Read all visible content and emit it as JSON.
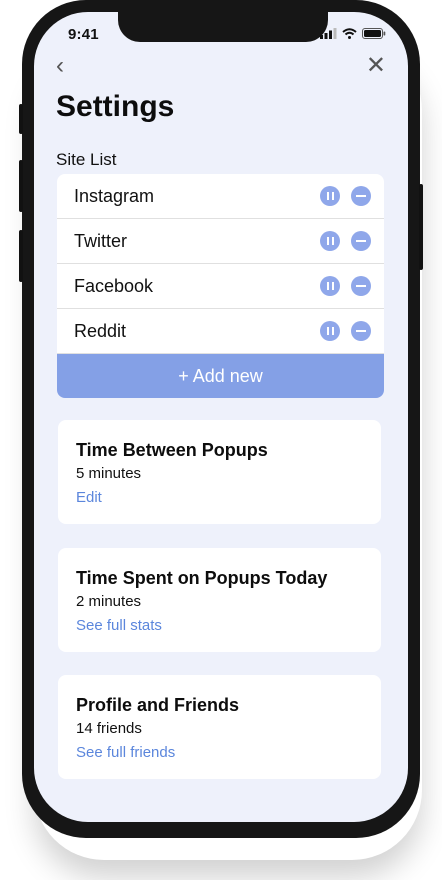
{
  "status_bar": {
    "time": "9:41"
  },
  "nav": {
    "back_glyph": "‹",
    "close_glyph": "✕"
  },
  "page": {
    "title": "Settings"
  },
  "site_list": {
    "label": "Site List",
    "items": [
      {
        "name": "Instagram"
      },
      {
        "name": "Twitter"
      },
      {
        "name": "Facebook"
      },
      {
        "name": "Reddit"
      }
    ],
    "add_label": "+ Add new"
  },
  "cards": [
    {
      "title": "Time Between Popups",
      "value": "5 minutes",
      "link": "Edit"
    },
    {
      "title": "Time Spent on Popups Today",
      "value": "2 minutes",
      "link": "See full stats"
    },
    {
      "title": "Profile and Friends",
      "value": "14 friends",
      "link": "See full friends"
    }
  ],
  "colors": {
    "accent": "#84a0e6",
    "link": "#5b86dc",
    "screen_bg": "#eef1fb"
  }
}
